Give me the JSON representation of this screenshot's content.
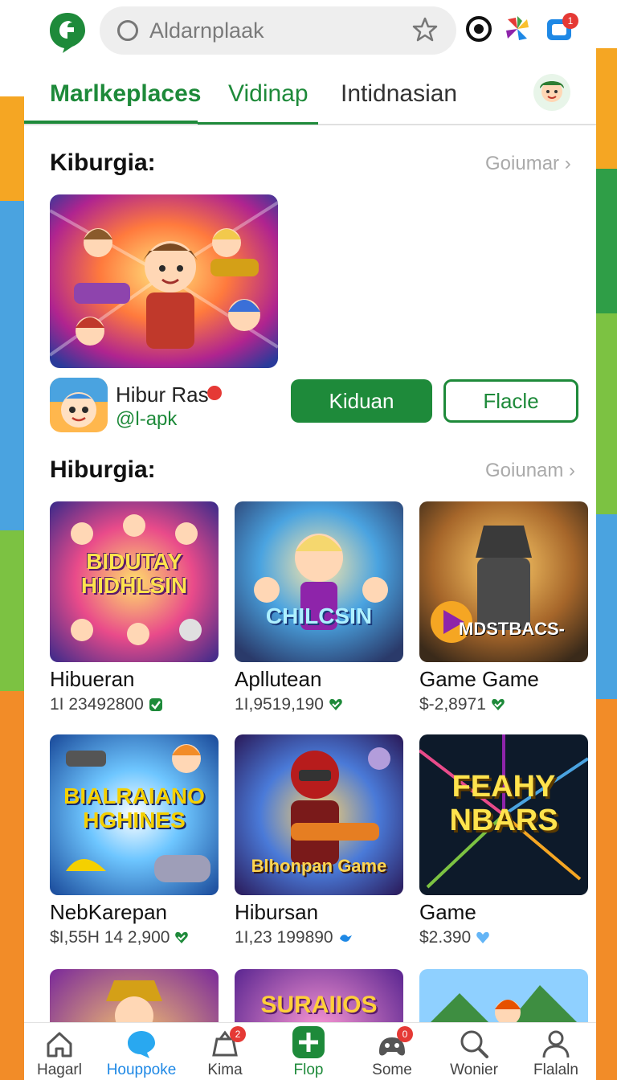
{
  "search": {
    "placeholder": "Aldarnplaak"
  },
  "tabs": [
    {
      "label": "Marlkeplaces"
    },
    {
      "label": "Vidinap"
    },
    {
      "label": "Intidnasian"
    }
  ],
  "featured": {
    "title": "Kiburgia:",
    "link": "Goiumar ›",
    "app_name": "Hibur Ras",
    "app_handle": "@l-apk",
    "primary_button": "Kiduan",
    "secondary_button": "Flacle"
  },
  "grid_section": {
    "title": "Hiburgia:",
    "link": "Goiunam ›",
    "cards": [
      {
        "name": "Hibueran",
        "meta": "1I 23492800",
        "overlay": "BIDUTAY HIDHLSIN",
        "check_color": "#1e8a3a"
      },
      {
        "name": "Apllutean",
        "meta": "1I,9519,190",
        "overlay": "CHILCSIN",
        "check_color": "#1e8a3a"
      },
      {
        "name": "Game Game",
        "meta": "$-2,8971",
        "overlay": "MDSTBACS-",
        "check_color": "#1e8a3a"
      },
      {
        "name": "NebKarepan",
        "meta": "$I,55H 14 2,900",
        "overlay": "BIALRAIANO HGHINES",
        "check_color": "#1e8a3a"
      },
      {
        "name": "Hibursan",
        "meta": "1I,23 199890",
        "overlay": "Blhonpan Game",
        "check_color": "#1e88e5"
      },
      {
        "name": "Game",
        "meta": "$2.390",
        "overlay": "FEAHY NBARS",
        "check_color": "#64b5f6"
      },
      {
        "name": "",
        "meta": "",
        "overlay": "",
        "check_color": ""
      },
      {
        "name": "",
        "meta": "",
        "overlay": "SURAIIOS",
        "check_color": ""
      },
      {
        "name": "",
        "meta": "",
        "overlay": "",
        "check_color": ""
      }
    ]
  },
  "badges": {
    "top_right": "1",
    "nav_kima": "2",
    "nav_some": "0"
  },
  "bottom_nav": [
    {
      "label": "Hagarl",
      "icon": "home-icon"
    },
    {
      "label": "Houppoke",
      "icon": "chat-icon"
    },
    {
      "label": "Kima",
      "icon": "gift-icon"
    },
    {
      "label": "Flop",
      "icon": "plus-icon"
    },
    {
      "label": "Some",
      "icon": "gamepad-icon"
    },
    {
      "label": "Wonier",
      "icon": "search-icon"
    },
    {
      "label": "Flalaln",
      "icon": "profile-icon"
    }
  ],
  "colors": {
    "accent": "#1e8a3a",
    "active_nav": "#1e88e5",
    "badge": "#e53935"
  }
}
